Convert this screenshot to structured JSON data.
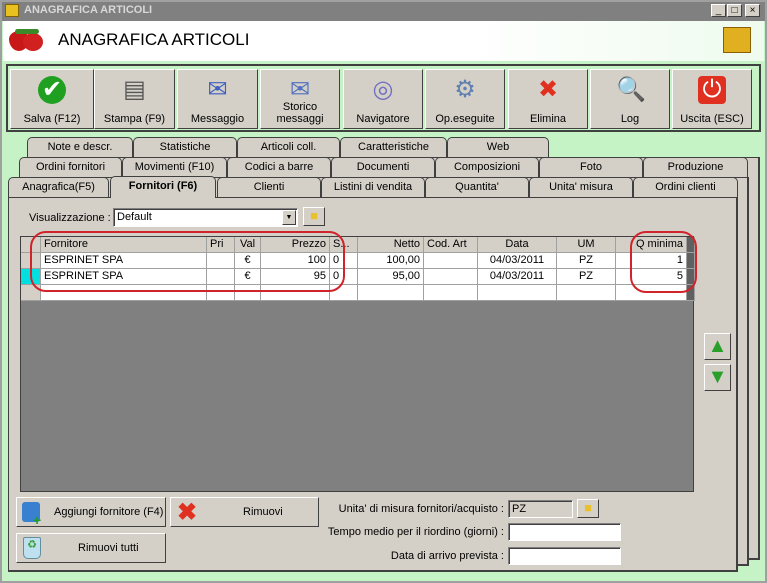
{
  "window": {
    "title": "ANAGRAFICA ARTICOLI",
    "min": "_",
    "max": "□",
    "close": "×"
  },
  "header": {
    "title": "ANAGRAFICA ARTICOLI"
  },
  "toolbar": [
    {
      "label": "Salva (F12)",
      "icon": "check-icon"
    },
    {
      "label": "Stampa (F9)",
      "icon": "printer-icon"
    },
    {
      "label": "Messaggio",
      "icon": "envelope-pen-icon"
    },
    {
      "label": "Storico messaggi",
      "icon": "envelope-search-icon"
    },
    {
      "label": "Navigatore",
      "icon": "compass-icon"
    },
    {
      "label": "Op.eseguite",
      "icon": "gears-icon"
    },
    {
      "label": "Elimina",
      "icon": "delete-x-icon"
    },
    {
      "label": "Log",
      "icon": "log-search-icon"
    },
    {
      "label": "Uscita (ESC)",
      "icon": "power-icon"
    }
  ],
  "tabs": {
    "row1": [
      "Note e descr.",
      "Statistiche",
      "Articoli coll.",
      "Caratteristiche",
      "Web"
    ],
    "row2": [
      "Ordini fornitori",
      "Movimenti (F10)",
      "Codici a barre",
      "Documenti",
      "Composizioni",
      "Foto",
      "Produzione"
    ],
    "row3": [
      "Anagrafica(F5)",
      "Fornitori (F6)",
      "Clienti",
      "Listini di vendita",
      "Quantita'",
      "Unita' misura",
      "Ordini clienti"
    ],
    "active": "Fornitori (F6)"
  },
  "view": {
    "label": "Visualizzazione :",
    "value": "Default"
  },
  "grid": {
    "columns": [
      "Fornitore",
      "Pri",
      "Val",
      "Prezzo",
      "S...",
      "Netto",
      "Cod. Art",
      "Data",
      "UM",
      "Q minima"
    ],
    "rows": [
      [
        "ESPRINET SPA",
        "",
        "€",
        "100",
        "0",
        "100,00",
        "",
        "04/03/2011",
        "PZ",
        "1"
      ],
      [
        "ESPRINET SPA",
        "",
        "€",
        "95",
        "0",
        "95,00",
        "",
        "04/03/2011",
        "PZ",
        "5"
      ]
    ]
  },
  "buttons": {
    "add": "Aggiungi fornitore (F4)",
    "remove": "Rimuovi",
    "remove_all": "Rimuovi tutti"
  },
  "fields": {
    "um_label": "Unita' di misura fornitori/acquisto :",
    "um_value": "PZ",
    "tempo_label": "Tempo medio per il riordino (giorni) :",
    "tempo_value": "",
    "data_label": "Data di arrivo prevista :",
    "data_value": ""
  }
}
